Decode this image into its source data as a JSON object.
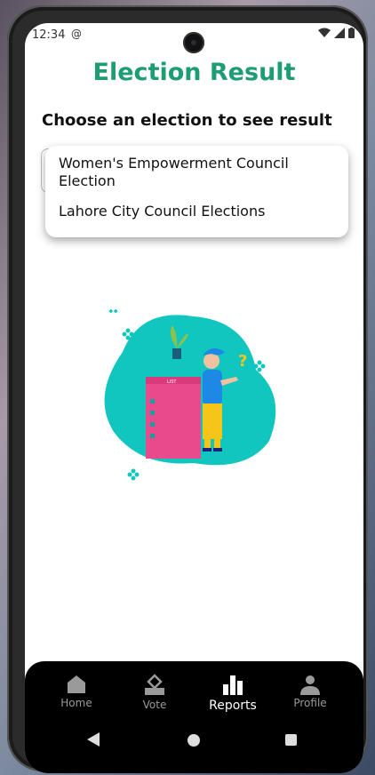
{
  "status_bar": {
    "time": "12:34",
    "at_icon": "at-icon",
    "icons": [
      "wifi-icon",
      "signal-icon",
      "battery-icon"
    ]
  },
  "header": {
    "title": "Election Result",
    "title_color": "#1f9d72"
  },
  "prompt": {
    "text": "Choose an election to see result"
  },
  "dropdown": {
    "items": [
      {
        "label": "Women's Empowerment Council Election"
      },
      {
        "label": "Lahore City Council Elections"
      }
    ]
  },
  "illustration": {
    "icon": "voting-list-illustration",
    "list_label": "LIST"
  },
  "bottom_nav": {
    "items": [
      {
        "label": "Home",
        "icon": "home-icon"
      },
      {
        "label": "Vote",
        "icon": "ballot-box-icon"
      },
      {
        "label": "Reports",
        "icon": "bar-chart-icon",
        "active": true
      },
      {
        "label": "Profile",
        "icon": "person-icon"
      }
    ]
  }
}
